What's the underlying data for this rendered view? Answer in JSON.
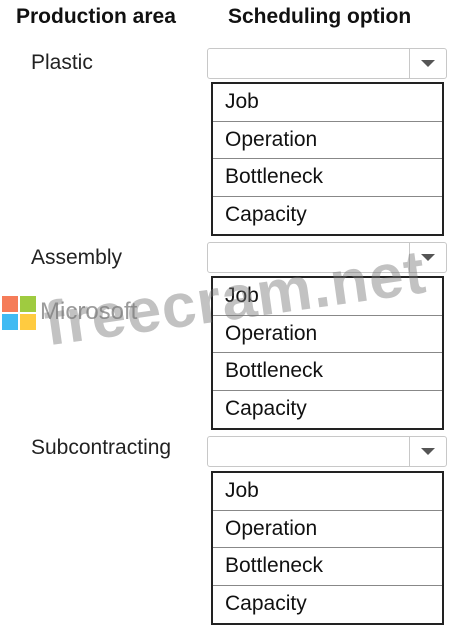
{
  "headers": {
    "production_area": "Production area",
    "scheduling_option": "Scheduling option"
  },
  "rows": [
    {
      "label": "Plastic",
      "selected": "",
      "options": [
        "Job",
        "Operation",
        "Bottleneck",
        "Capacity"
      ]
    },
    {
      "label": "Assembly",
      "selected": "",
      "options": [
        "Job",
        "Operation",
        "Bottleneck",
        "Capacity"
      ]
    },
    {
      "label": "Subcontracting",
      "selected": "",
      "options": [
        "Job",
        "Operation",
        "Bottleneck",
        "Capacity"
      ]
    }
  ],
  "watermark": {
    "brand": "Microsoft",
    "site": "freecram.net"
  },
  "colors": {
    "microsoft_red": "#f25022",
    "microsoft_green": "#7fba00",
    "microsoft_blue": "#00a4ef",
    "microsoft_yellow": "#ffb900"
  }
}
